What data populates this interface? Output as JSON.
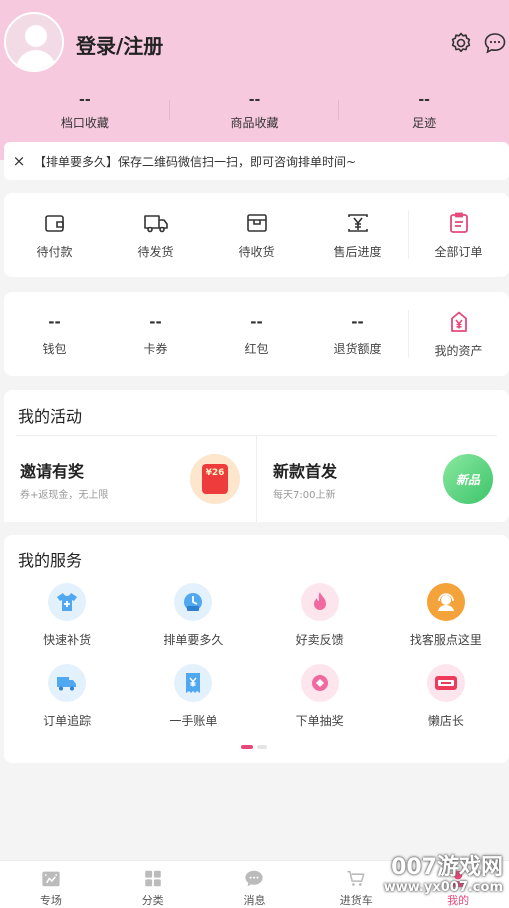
{
  "header": {
    "login_label": "登录/注册"
  },
  "stats": [
    {
      "value": "--",
      "label": "档口收藏"
    },
    {
      "value": "--",
      "label": "商品收藏"
    },
    {
      "value": "--",
      "label": "足迹"
    }
  ],
  "notice": {
    "close": "×",
    "text": "【排单要多久】保存二维码微信扫一扫，即可咨询排单时间~"
  },
  "orders": {
    "items": [
      "待付款",
      "待发货",
      "待收货",
      "售后进度"
    ],
    "all_label": "全部订单"
  },
  "assets": {
    "items": [
      {
        "value": "--",
        "label": "钱包"
      },
      {
        "value": "--",
        "label": "卡券"
      },
      {
        "value": "--",
        "label": "红包"
      },
      {
        "value": "--",
        "label": "退货额度"
      }
    ],
    "all_label": "我的资产"
  },
  "activities": {
    "title": "我的活动",
    "items": [
      {
        "title": "邀请有奖",
        "subtitle": "券+返现金，无上限",
        "badge": "¥26"
      },
      {
        "title": "新款首发",
        "subtitle": "每天7:00上新",
        "badge": "新品"
      }
    ]
  },
  "services": {
    "title": "我的服务",
    "items": [
      "快速补货",
      "排单要多久",
      "好卖反馈",
      "找客服点这里",
      "订单追踪",
      "一手账单",
      "下单抽奖",
      "懒店长"
    ]
  },
  "tabbar": {
    "items": [
      "专场",
      "分类",
      "消息",
      "进货车",
      "我的"
    ],
    "active": "我的"
  },
  "watermark": {
    "big": "007游戏网",
    "small": "www.yx007.com"
  },
  "colors": {
    "header_bg": "#f7c9df",
    "accent": "#e8477a",
    "service_blue": "#4fa8f0",
    "service_pink": "#f06aa0",
    "service_orange": "#f4a23a"
  }
}
